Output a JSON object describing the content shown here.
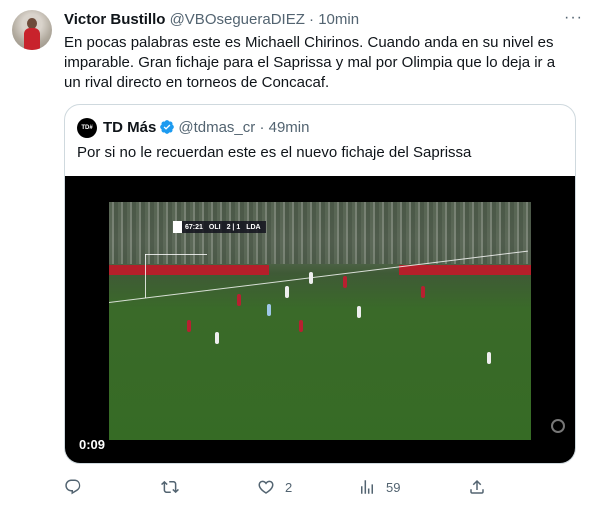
{
  "tweet": {
    "author_name": "Victor Bustillo",
    "author_handle": "@VBOsegueraDIEZ",
    "separator": "·",
    "time": "10min",
    "more_label": "···",
    "text": "En pocas palabras este es Michaell Chirinos. Cuando anda en su nivel es\nimparable. Gran fichaje para el Saprissa y mal por Olimpia que lo deja ir a\nun rival directo en torneos de Concacaf."
  },
  "quote": {
    "avatar_text": "TD#",
    "author_name": "TD Más",
    "author_handle": "@tdmas_cr",
    "separator": "·",
    "time": "49min",
    "text": "Por si no le recuerdan este es el nuevo fichaje del Saprissa",
    "video": {
      "duration": "0:09",
      "scorebug": {
        "clock": "67:21",
        "home": "OLI",
        "score": "2 | 1",
        "away": "LDA"
      }
    }
  },
  "actions": {
    "reply_count": "",
    "retweet_count": "",
    "like_count": "2",
    "views_count": "59"
  },
  "colors": {
    "secondary_text": "#536471",
    "border": "#cfd9de",
    "verified": "#1d9bf0"
  },
  "icons": [
    "more-icon",
    "verified-icon",
    "reply-icon",
    "retweet-icon",
    "like-icon",
    "views-icon",
    "share-icon"
  ]
}
